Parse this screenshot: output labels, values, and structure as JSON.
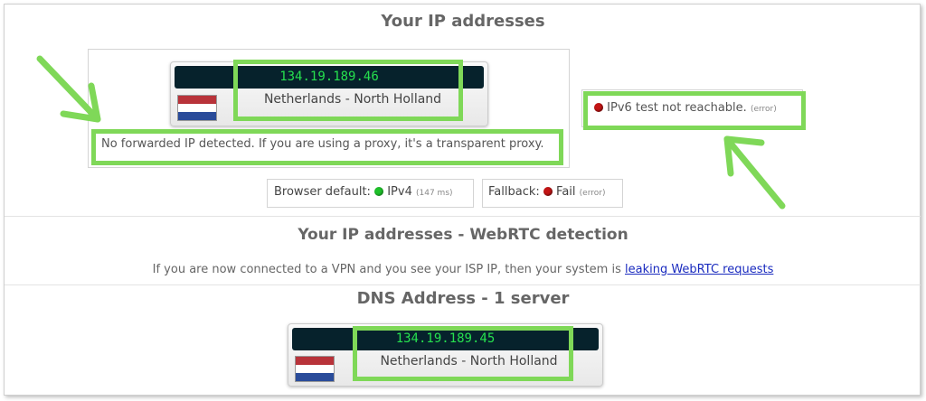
{
  "section1": {
    "title": "Your IP addresses",
    "ip_card": {
      "ip": "134.19.189.46",
      "location": "Netherlands - North Holland",
      "flag": "netherlands-flag"
    },
    "forwarded_note": "No forwarded IP detected. If you are using a proxy, it's a transparent proxy.",
    "ipv6": {
      "label": "IPv6 test not reachable.",
      "status": "(error)"
    },
    "browser_default": {
      "label": "Browser default:",
      "value": "IPv4",
      "timing": "(147 ms)"
    },
    "fallback": {
      "label": "Fallback:",
      "value": "Fail",
      "status": "(error)"
    }
  },
  "section2": {
    "title": "Your IP addresses - WebRTC detection",
    "text": "If you are now connected to a VPN and you see your ISP IP, then your system is",
    "link": "leaking WebRTC requests"
  },
  "section3": {
    "title": "DNS Address - 1 server",
    "ip_card": {
      "ip": "134.19.189.45",
      "location": "Netherlands - North Holland",
      "flag": "netherlands-flag"
    }
  },
  "colors": {
    "highlight": "#7fd858",
    "ip_bar_bg": "#06222c",
    "ip_text": "#26e04e",
    "status_red": "#c41515",
    "status_green": "#1ec12a",
    "link": "#1a2bbf"
  }
}
